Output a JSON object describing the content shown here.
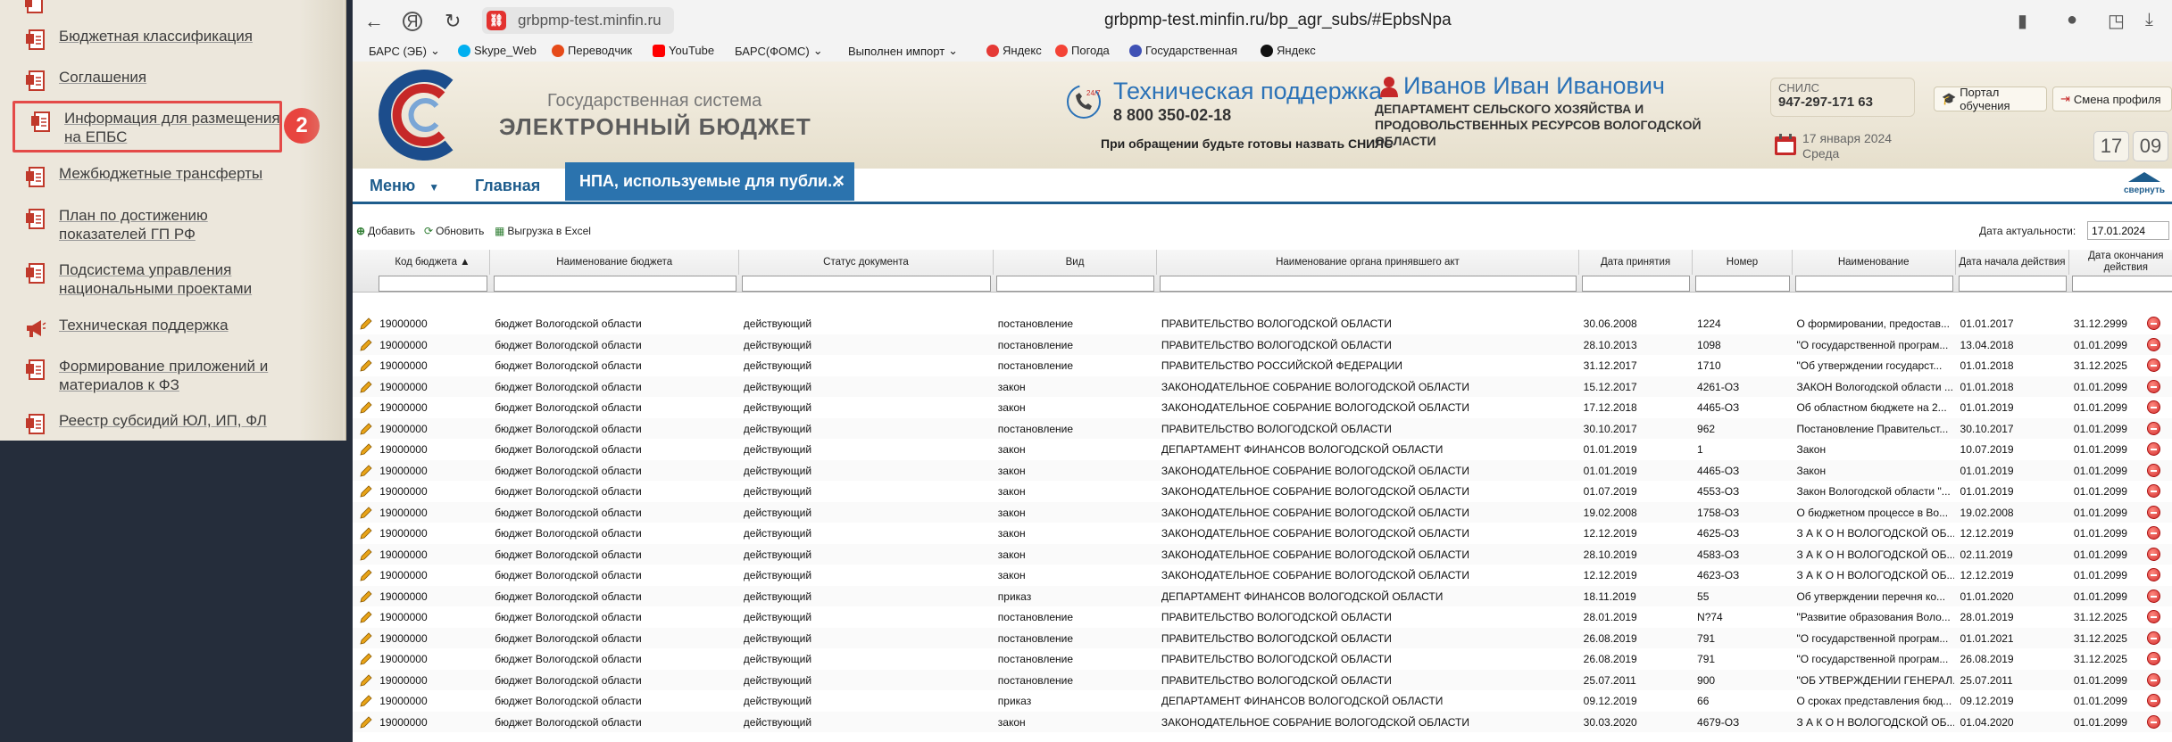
{
  "left_menu": {
    "items": [
      {
        "label": "Бюджетная классификация"
      },
      {
        "label": "Соглашения"
      },
      {
        "label": "Информация для размещения на ЕПБС"
      },
      {
        "label": "Межбюджетные трансферты"
      },
      {
        "label": "План по достижению показателей ГП РФ"
      },
      {
        "label": "Подсистема управления национальными проектами"
      },
      {
        "label": "Техническая поддержка"
      },
      {
        "label": "Формирование приложений и материалов к ФЗ"
      },
      {
        "label": "Реестр субсидий ЮЛ, ИП, ФЛ"
      }
    ],
    "step_badge": "2"
  },
  "browser": {
    "url_short": "grbpmp-test.minfin.ru",
    "url_full": "grbpmp-test.minfin.ru/bp_agr_subs/#EpbsNpa",
    "bookmarks": [
      "БАРС (ЭБ)",
      "Skype_Web",
      "Переводчик",
      "YouTube",
      "БАРС(ФОМС)",
      "Выполнен импорт",
      "Яндекс",
      "Погода",
      "Государственная",
      "Яндекс"
    ]
  },
  "header": {
    "system_name_line1": "Государственная система",
    "system_name_line2": "ЭЛЕКТРОННЫЙ БЮДЖЕТ",
    "support_badge": "24/7",
    "support_title": "Техническая поддержка",
    "support_phone": "8 800 350-02-18",
    "support_note": "При обращении будьте готовы назвать СНИЛС",
    "user_name": "Иванов Иван Иванович",
    "user_dept": "ДЕПАРТАМЕНТ СЕЛЬСКОГО ХОЗЯЙСТВА И ПРОДОВОЛЬСТВЕННЫХ РЕСУРСОВ ВОЛОГОДСКОЙ ОБЛАСТИ",
    "snils_label": "СНИЛС",
    "snils_value": "947-297-171 63",
    "date": "17 января 2024",
    "weekday": "Среда",
    "portal_btn": "Портал обучения",
    "profile_btn": "Смена профиля",
    "clock_hour": "17",
    "clock_min": "09"
  },
  "nav": {
    "menu": "Меню",
    "home": "Главная",
    "active_tab": "НПА, используемые для публи...",
    "collapse": "свернуть"
  },
  "toolbar": {
    "add": "Добавить",
    "refresh": "Обновить",
    "export": "Выгрузка в Excel",
    "actuality_label": "Дата актуальности:",
    "actuality_value": "17.01.2024"
  },
  "grid": {
    "columns": [
      {
        "label": "Код бюджета ▲"
      },
      {
        "label": "Наименование бюджета"
      },
      {
        "label": "Статус документа"
      },
      {
        "label": "Вид"
      },
      {
        "label": "Наименование органа принявшего акт"
      },
      {
        "label": "Дата принятия"
      },
      {
        "label": "Номер"
      },
      {
        "label": "Наименование"
      },
      {
        "label": "Дата начала действия"
      },
      {
        "label": "Дата окончания действия"
      }
    ],
    "rows": [
      [
        "19000000",
        "бюджет Вологодской области",
        "действующий",
        "постановление",
        "ПРАВИТЕЛЬСТВО ВОЛОГОДСКОЙ ОБЛАСТИ",
        "30.06.2008",
        "1224",
        "О формировании, предостав...",
        "01.01.2017",
        "31.12.2999"
      ],
      [
        "19000000",
        "бюджет Вологодской области",
        "действующий",
        "постановление",
        "ПРАВИТЕЛЬСТВО ВОЛОГОДСКОЙ ОБЛАСТИ",
        "28.10.2013",
        "1098",
        "\"О государственной програм...",
        "13.04.2018",
        "01.01.2099"
      ],
      [
        "19000000",
        "бюджет Вологодской области",
        "действующий",
        "постановление",
        "ПРАВИТЕЛЬСТВО РОССИЙСКОЙ ФЕДЕРАЦИИ",
        "31.12.2017",
        "1710",
        "\"Об утверждении государст...",
        "01.01.2018",
        "31.12.2025"
      ],
      [
        "19000000",
        "бюджет Вологодской области",
        "действующий",
        "закон",
        "ЗАКОНОДАТЕЛЬНОЕ СОБРАНИЕ ВОЛОГОДСКОЙ ОБЛАСТИ",
        "15.12.2017",
        "4261-ОЗ",
        "ЗАКОН Вологодской области ...",
        "01.01.2018",
        "01.01.2099"
      ],
      [
        "19000000",
        "бюджет Вологодской области",
        "действующий",
        "закон",
        "ЗАКОНОДАТЕЛЬНОЕ СОБРАНИЕ ВОЛОГОДСКОЙ ОБЛАСТИ",
        "17.12.2018",
        "4465-ОЗ",
        "Об областном бюджете на 2...",
        "01.01.2019",
        "01.01.2099"
      ],
      [
        "19000000",
        "бюджет Вологодской области",
        "действующий",
        "постановление",
        "ПРАВИТЕЛЬСТВО ВОЛОГОДСКОЙ ОБЛАСТИ",
        "30.10.2017",
        "962",
        "Постановление Правительст...",
        "30.10.2017",
        "01.01.2099"
      ],
      [
        "19000000",
        "бюджет Вологодской области",
        "действующий",
        "закон",
        "ДЕПАРТАМЕНТ ФИНАНСОВ ВОЛОГОДСКОЙ ОБЛАСТИ",
        "01.01.2019",
        "1",
        "Закон",
        "10.07.2019",
        "01.01.2099"
      ],
      [
        "19000000",
        "бюджет Вологодской области",
        "действующий",
        "закон",
        "ЗАКОНОДАТЕЛЬНОЕ СОБРАНИЕ ВОЛОГОДСКОЙ ОБЛАСТИ",
        "01.01.2019",
        "4465-ОЗ",
        "Закон",
        "01.01.2019",
        "01.01.2099"
      ],
      [
        "19000000",
        "бюджет Вологодской области",
        "действующий",
        "закон",
        "ЗАКОНОДАТЕЛЬНОЕ СОБРАНИЕ ВОЛОГОДСКОЙ ОБЛАСТИ",
        "01.07.2019",
        "4553-ОЗ",
        "Закон Вологодской области \"...",
        "01.01.2019",
        "01.01.2099"
      ],
      [
        "19000000",
        "бюджет Вологодской области",
        "действующий",
        "закон",
        "ЗАКОНОДАТЕЛЬНОЕ СОБРАНИЕ ВОЛОГОДСКОЙ ОБЛАСТИ",
        "19.02.2008",
        "1758-ОЗ",
        "О бюджетном процессе в Во...",
        "19.02.2008",
        "01.01.2099"
      ],
      [
        "19000000",
        "бюджет Вологодской области",
        "действующий",
        "закон",
        "ЗАКОНОДАТЕЛЬНОЕ СОБРАНИЕ ВОЛОГОДСКОЙ ОБЛАСТИ",
        "12.12.2019",
        "4625-ОЗ",
        "З А К О Н ВОЛОГОДСКОЙ ОБ...",
        "12.12.2019",
        "01.01.2099"
      ],
      [
        "19000000",
        "бюджет Вологодской области",
        "действующий",
        "закон",
        "ЗАКОНОДАТЕЛЬНОЕ СОБРАНИЕ ВОЛОГОДСКОЙ ОБЛАСТИ",
        "28.10.2019",
        "4583-ОЗ",
        "З А К О Н ВОЛОГОДСКОЙ ОБ...",
        "02.11.2019",
        "01.01.2099"
      ],
      [
        "19000000",
        "бюджет Вологодской области",
        "действующий",
        "закон",
        "ЗАКОНОДАТЕЛЬНОЕ СОБРАНИЕ ВОЛОГОДСКОЙ ОБЛАСТИ",
        "12.12.2019",
        "4623-ОЗ",
        "З А К О Н ВОЛОГОДСКОЙ ОБ...",
        "12.12.2019",
        "01.01.2099"
      ],
      [
        "19000000",
        "бюджет Вологодской области",
        "действующий",
        "приказ",
        "ДЕПАРТАМЕНТ ФИНАНСОВ ВОЛОГОДСКОЙ ОБЛАСТИ",
        "18.11.2019",
        "55",
        "Об утверждении перечня ко...",
        "01.01.2020",
        "01.01.2099"
      ],
      [
        "19000000",
        "бюджет Вологодской области",
        "действующий",
        "постановление",
        "ПРАВИТЕЛЬСТВО ВОЛОГОДСКОЙ ОБЛАСТИ",
        "28.01.2019",
        "N?74",
        "\"Развитие образования Воло...",
        "28.01.2019",
        "31.12.2025"
      ],
      [
        "19000000",
        "бюджет Вологодской области",
        "действующий",
        "постановление",
        "ПРАВИТЕЛЬСТВО ВОЛОГОДСКОЙ ОБЛАСТИ",
        "26.08.2019",
        "791",
        "\"О государственной програм...",
        "01.01.2021",
        "31.12.2025"
      ],
      [
        "19000000",
        "бюджет Вологодской области",
        "действующий",
        "постановление",
        "ПРАВИТЕЛЬСТВО ВОЛОГОДСКОЙ ОБЛАСТИ",
        "26.08.2019",
        "791",
        "\"О государственной програм...",
        "26.08.2019",
        "31.12.2025"
      ],
      [
        "19000000",
        "бюджет Вологодской области",
        "действующий",
        "постановление",
        "ПРАВИТЕЛЬСТВО ВОЛОГОДСКОЙ ОБЛАСТИ",
        "25.07.2011",
        "900",
        "\"ОБ УТВЕРЖДЕНИИ ГЕНЕРАЛ...",
        "25.07.2011",
        "01.01.2099"
      ],
      [
        "19000000",
        "бюджет Вологодской области",
        "действующий",
        "приказ",
        "ДЕПАРТАМЕНТ ФИНАНСОВ ВОЛОГОДСКОЙ ОБЛАСТИ",
        "09.12.2019",
        "66",
        "О сроках представления бюд...",
        "09.12.2019",
        "01.01.2099"
      ],
      [
        "19000000",
        "бюджет Вологодской области",
        "действующий",
        "закон",
        "ЗАКОНОДАТЕЛЬНОЕ СОБРАНИЕ ВОЛОГОДСКОЙ ОБЛАСТИ",
        "30.03.2020",
        "4679-ОЗ",
        "З А К О Н ВОЛОГОДСКОЙ ОБ...",
        "01.04.2020",
        "01.01.2099"
      ]
    ]
  }
}
